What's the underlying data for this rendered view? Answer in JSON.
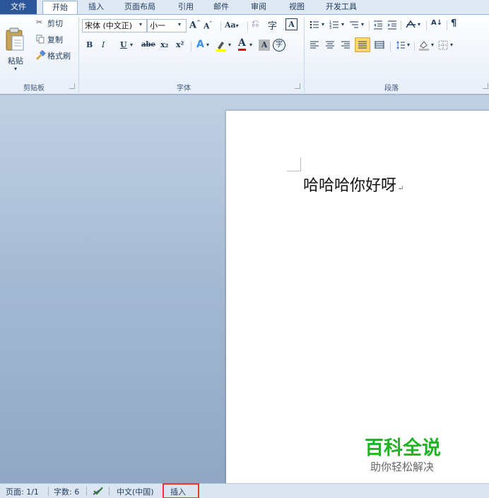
{
  "tabs": {
    "file": "文件",
    "home": "开始",
    "insert": "插入",
    "page_layout": "页面布局",
    "references": "引用",
    "mailings": "邮件",
    "review": "审阅",
    "view": "视图",
    "developer": "开发工具"
  },
  "clipboard": {
    "paste": "粘贴",
    "cut": "剪切",
    "copy": "复制",
    "format_painter": "格式刷",
    "group_label": "剪贴板"
  },
  "font": {
    "font_name": "宋体 (中文正)",
    "font_size": "小一",
    "grow": "A",
    "shrink": "A",
    "change_case": "Aa",
    "bold": "B",
    "italic": "I",
    "underline": "U",
    "strikethrough": "abe",
    "subscript": "x₂",
    "superscript": "x²",
    "font_color": "A",
    "char_shading": "A",
    "enclose": "字",
    "group_label": "字体"
  },
  "paragraph": {
    "sort": "A↓",
    "group_label": "段落"
  },
  "document": {
    "text": "哈哈哈你好呀",
    "paragraph_mark": "↵"
  },
  "watermark": {
    "title": "百科全说",
    "subtitle": "助你轻松解决"
  },
  "status": {
    "page": "页面: 1/1",
    "words": "字数: 6",
    "language": "中文(中国)",
    "mode": "插入"
  },
  "colors": {
    "file_tab": "#2b579a",
    "watermark_green": "#21b324",
    "highlight_box": "#e33333"
  }
}
